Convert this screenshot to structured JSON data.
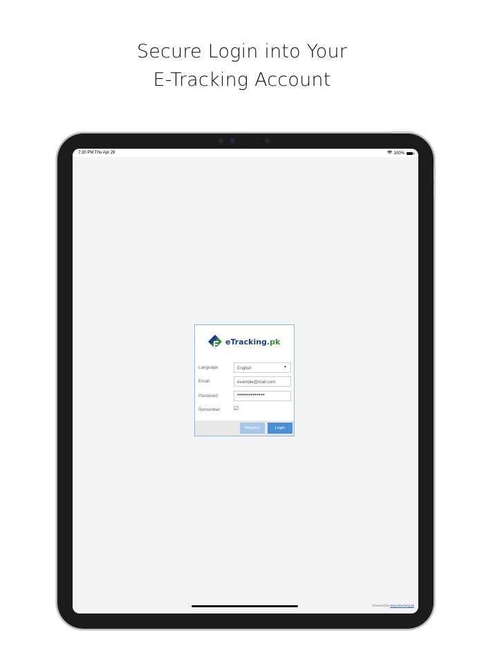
{
  "headline": {
    "line1": "Secure Login into Your",
    "line2": "E-Tracking Account"
  },
  "status_bar": {
    "time_date": "7:30 PM  Thu Apr 29",
    "battery": "100%"
  },
  "login": {
    "brand_main": "eTracking",
    "brand_suffix": ".pk",
    "language_label": "Language:",
    "language_value": "English",
    "email_label": "Email:",
    "email_placeholder": "example@mail.com",
    "password_label": "Password:",
    "password_value": "••••••••••••••",
    "remember_label": "Remember:",
    "remember_checked": true,
    "register_label": "Register",
    "login_label": "Login"
  },
  "footer": {
    "powered_prefix": "Powered by",
    "powered_link": "www.etracking.pk"
  },
  "colors": {
    "login_button": "#4a90d9",
    "register_button": "#a7c8e8",
    "card_border": "#8fb6dd",
    "brand_blue": "#1b3e8a",
    "brand_green": "#2d8f2d"
  }
}
